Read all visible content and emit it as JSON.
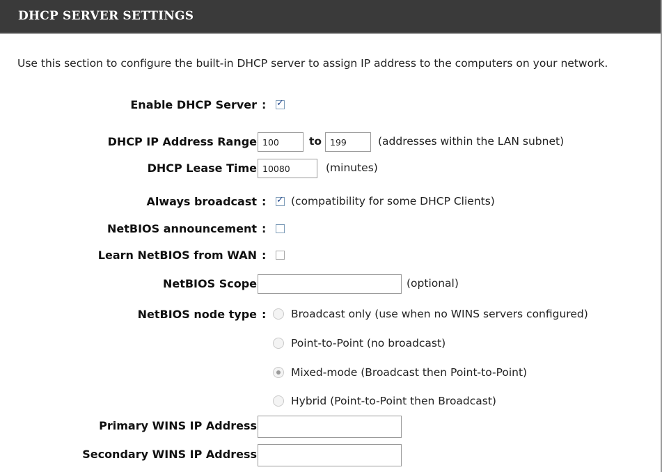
{
  "header": {
    "title": "DHCP SERVER SETTINGS"
  },
  "description": "Use this section to configure the built-in DHCP server to assign IP address to the computers on your network.",
  "fields": {
    "enable_dhcp": {
      "label": "Enable DHCP Server",
      "checked": true
    },
    "ip_range": {
      "label": "DHCP IP Address Range",
      "start": "100",
      "to_label": "to",
      "end": "199",
      "hint": "(addresses within the LAN subnet)"
    },
    "lease_time": {
      "label": "DHCP Lease Time",
      "value": "10080",
      "hint": "(minutes)"
    },
    "always_broadcast": {
      "label": "Always broadcast",
      "checked": true,
      "hint": "(compatibility for some DHCP Clients)"
    },
    "netbios_announcement": {
      "label": "NetBIOS announcement",
      "checked": false
    },
    "learn_netbios": {
      "label": "Learn NetBIOS from WAN",
      "checked": false
    },
    "netbios_scope": {
      "label": "NetBIOS Scope",
      "value": "",
      "hint": "(optional)"
    },
    "netbios_node_type": {
      "label": "NetBIOS node type",
      "options": [
        "Broadcast only (use when no WINS servers configured)",
        "Point-to-Point (no broadcast)",
        "Mixed-mode (Broadcast then Point-to-Point)",
        "Hybrid (Point-to-Point then Broadcast)"
      ],
      "selected": "Mixed-mode (Broadcast then Point-to-Point)"
    },
    "primary_wins": {
      "label": "Primary WINS IP Address",
      "value": ""
    },
    "secondary_wins": {
      "label": "Secondary WINS IP Address",
      "value": ""
    }
  },
  "colon": ":"
}
